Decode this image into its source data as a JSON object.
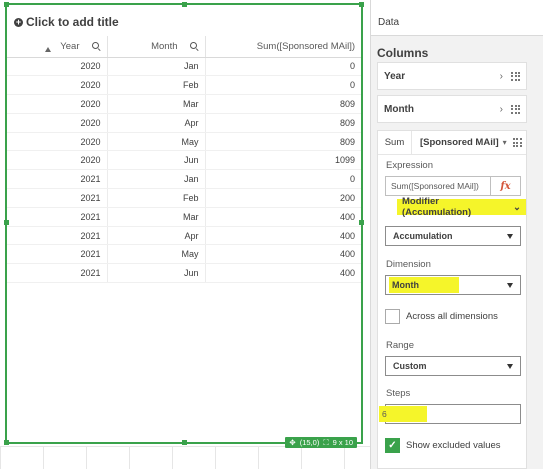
{
  "sheet": {
    "title_placeholder": "Click to add title",
    "table": {
      "headers": [
        "Year",
        "Month",
        "Sum([Sponsored MAil])"
      ],
      "rows": [
        [
          "2020",
          "Jan",
          "0"
        ],
        [
          "2020",
          "Feb",
          "0"
        ],
        [
          "2020",
          "Mar",
          "809"
        ],
        [
          "2020",
          "Apr",
          "809"
        ],
        [
          "2020",
          "May",
          "809"
        ],
        [
          "2020",
          "Jun",
          "1099"
        ],
        [
          "2021",
          "Jan",
          "0"
        ],
        [
          "2021",
          "Feb",
          "200"
        ],
        [
          "2021",
          "Mar",
          "400"
        ],
        [
          "2021",
          "Apr",
          "400"
        ],
        [
          "2021",
          "May",
          "400"
        ],
        [
          "2021",
          "Jun",
          "400"
        ]
      ]
    },
    "status": {
      "position": "(15,0)",
      "size": "9 x 10"
    }
  },
  "panel": {
    "tab": "Data",
    "section_title": "Columns",
    "columns": [
      {
        "label": "Year"
      },
      {
        "label": "Month"
      }
    ],
    "expanded": {
      "tab_agg": "Sum",
      "tab_field": "[Sponsored MAil]",
      "expression_label": "Expression",
      "expression_value": "Sum([Sponsored MAil])",
      "fx_label": "fx",
      "modifier_label": "Modifier (Accumulation)",
      "modifier_select": "Accumulation",
      "dimension_label": "Dimension",
      "dimension_value": "Month",
      "across_all_label": "Across all dimensions",
      "range_label": "Range",
      "range_value": "Custom",
      "steps_label": "Steps",
      "steps_value": "6",
      "show_excluded_label": "Show excluded values"
    }
  },
  "colors": {
    "accent": "#3aa24b",
    "highlight": "#f5f52a",
    "fx": "#d4553a"
  }
}
